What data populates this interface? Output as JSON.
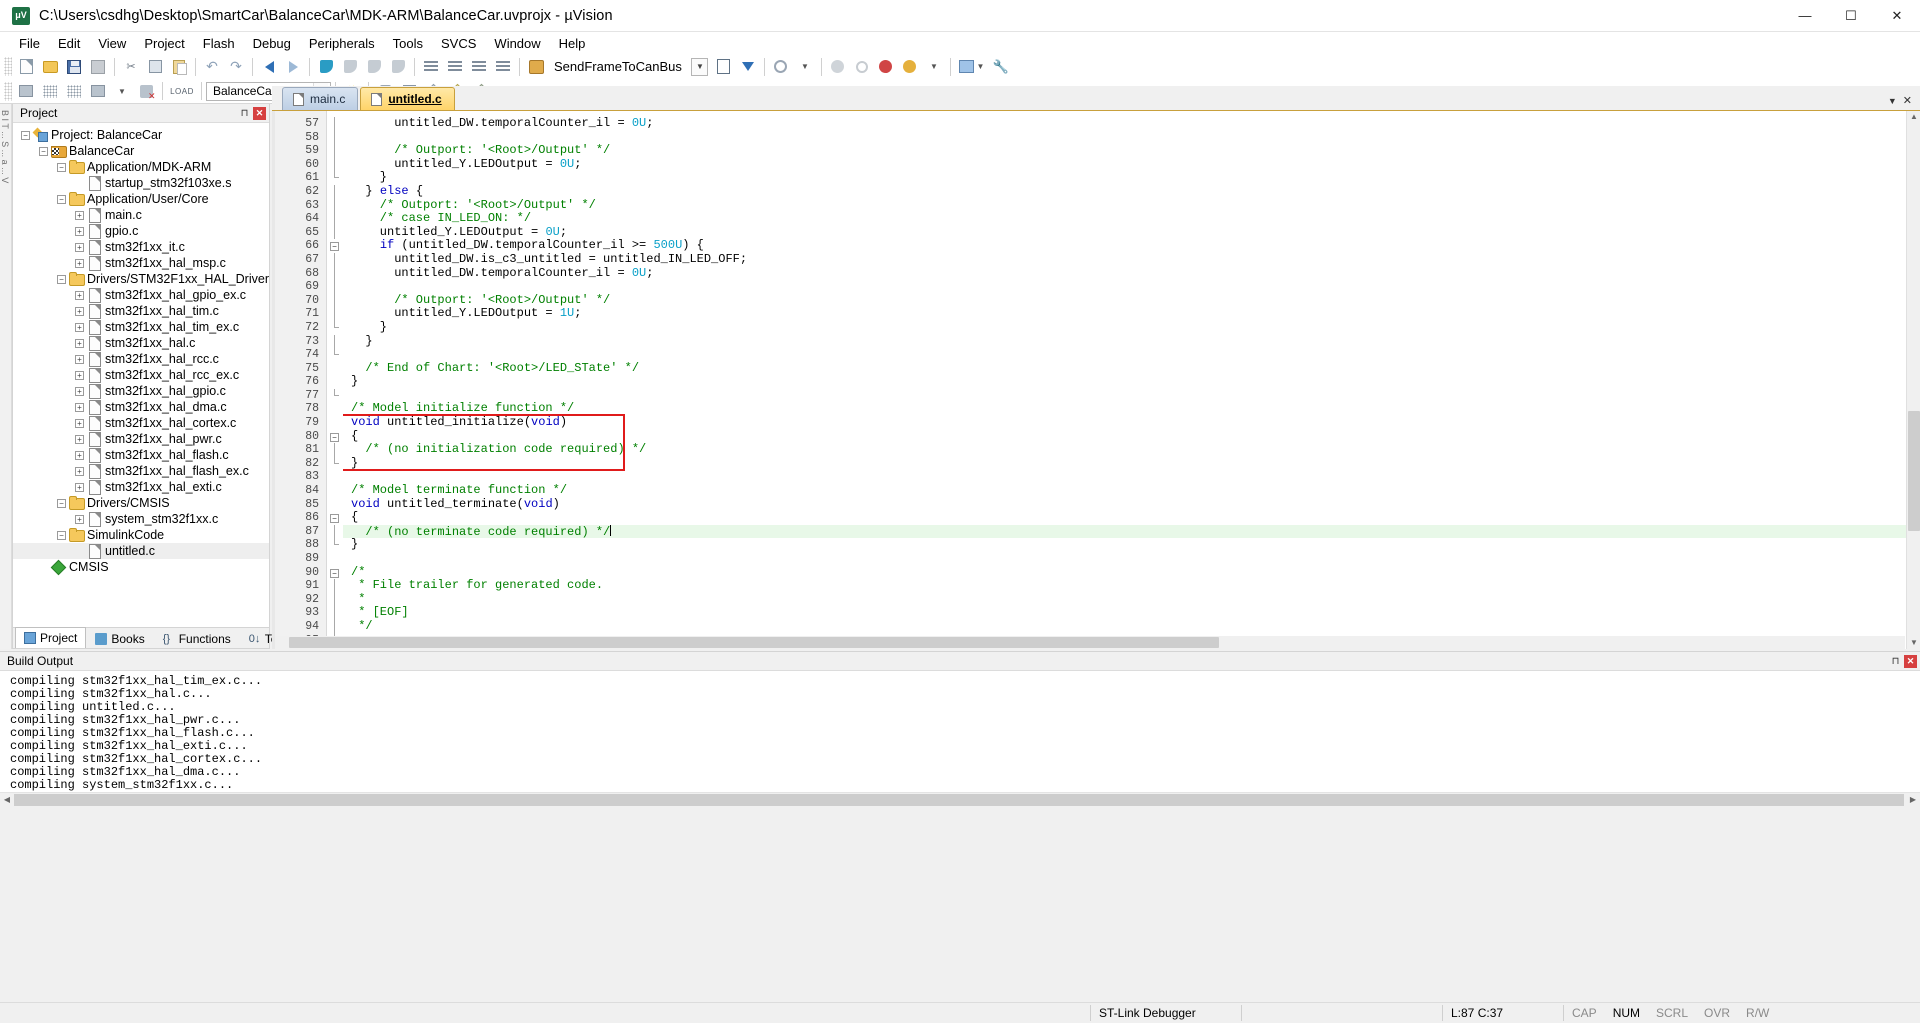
{
  "window": {
    "title": "C:\\Users\\csdhg\\Desktop\\SmartCar\\BalanceCar\\MDK-ARM\\BalanceCar.uvprojx - µVision",
    "app_icon_text": "μV",
    "minimize": "—",
    "maximize": "☐",
    "close": "✕"
  },
  "menu": [
    {
      "label": "File"
    },
    {
      "label": "Edit"
    },
    {
      "label": "View"
    },
    {
      "label": "Project"
    },
    {
      "label": "Flash"
    },
    {
      "label": "Debug"
    },
    {
      "label": "Peripherals"
    },
    {
      "label": "Tools"
    },
    {
      "label": "SVCS"
    },
    {
      "label": "Window"
    },
    {
      "label": "Help"
    }
  ],
  "toolbar": {
    "target_combo_value": "SendFrameToCanBus",
    "project_combo_value": "BalanceCar",
    "load_label": "LOAD"
  },
  "left_strip_text": "B I T ... S ... a ... V",
  "project_panel": {
    "header": "Project",
    "pin_icon": "pin-icon",
    "close_icon": "close-icon",
    "tree": [
      {
        "depth": 0,
        "label": "Project: BalanceCar",
        "icon": "project-icon",
        "expander": "minus"
      },
      {
        "depth": 1,
        "label": "BalanceCar",
        "icon": "target-icon",
        "expander": "minus"
      },
      {
        "depth": 2,
        "label": "Application/MDK-ARM",
        "icon": "folder-icon",
        "expander": "minus"
      },
      {
        "depth": 3,
        "label": "startup_stm32f103xe.s",
        "icon": "file-icon",
        "expander": "none"
      },
      {
        "depth": 2,
        "label": "Application/User/Core",
        "icon": "folder-icon",
        "expander": "minus"
      },
      {
        "depth": 3,
        "label": "main.c",
        "icon": "file-icon",
        "expander": "plus"
      },
      {
        "depth": 3,
        "label": "gpio.c",
        "icon": "file-icon",
        "expander": "plus"
      },
      {
        "depth": 3,
        "label": "stm32f1xx_it.c",
        "icon": "file-icon",
        "expander": "plus"
      },
      {
        "depth": 3,
        "label": "stm32f1xx_hal_msp.c",
        "icon": "file-icon",
        "expander": "plus"
      },
      {
        "depth": 2,
        "label": "Drivers/STM32F1xx_HAL_Driver",
        "icon": "folder-icon",
        "expander": "minus"
      },
      {
        "depth": 3,
        "label": "stm32f1xx_hal_gpio_ex.c",
        "icon": "file-icon",
        "expander": "plus"
      },
      {
        "depth": 3,
        "label": "stm32f1xx_hal_tim.c",
        "icon": "file-icon",
        "expander": "plus"
      },
      {
        "depth": 3,
        "label": "stm32f1xx_hal_tim_ex.c",
        "icon": "file-icon",
        "expander": "plus"
      },
      {
        "depth": 3,
        "label": "stm32f1xx_hal.c",
        "icon": "file-icon",
        "expander": "plus"
      },
      {
        "depth": 3,
        "label": "stm32f1xx_hal_rcc.c",
        "icon": "file-icon",
        "expander": "plus"
      },
      {
        "depth": 3,
        "label": "stm32f1xx_hal_rcc_ex.c",
        "icon": "file-icon",
        "expander": "plus"
      },
      {
        "depth": 3,
        "label": "stm32f1xx_hal_gpio.c",
        "icon": "file-icon",
        "expander": "plus"
      },
      {
        "depth": 3,
        "label": "stm32f1xx_hal_dma.c",
        "icon": "file-icon",
        "expander": "plus"
      },
      {
        "depth": 3,
        "label": "stm32f1xx_hal_cortex.c",
        "icon": "file-icon",
        "expander": "plus"
      },
      {
        "depth": 3,
        "label": "stm32f1xx_hal_pwr.c",
        "icon": "file-icon",
        "expander": "plus"
      },
      {
        "depth": 3,
        "label": "stm32f1xx_hal_flash.c",
        "icon": "file-icon",
        "expander": "plus"
      },
      {
        "depth": 3,
        "label": "stm32f1xx_hal_flash_ex.c",
        "icon": "file-icon",
        "expander": "plus"
      },
      {
        "depth": 3,
        "label": "stm32f1xx_hal_exti.c",
        "icon": "file-icon",
        "expander": "plus"
      },
      {
        "depth": 2,
        "label": "Drivers/CMSIS",
        "icon": "folder-icon",
        "expander": "minus"
      },
      {
        "depth": 3,
        "label": "system_stm32f1xx.c",
        "icon": "file-icon",
        "expander": "plus"
      },
      {
        "depth": 2,
        "label": "SimulinkCode",
        "icon": "folder-icon",
        "expander": "minus"
      },
      {
        "depth": 3,
        "label": "untitled.c",
        "icon": "file-icon",
        "expander": "none",
        "selected": true
      },
      {
        "depth": 1,
        "label": "CMSIS",
        "icon": "cmsis-icon",
        "expander": "none"
      }
    ],
    "tabs": [
      {
        "label": "Project",
        "icon": "project-icon",
        "active": true
      },
      {
        "label": "Books",
        "icon": "books-icon",
        "active": false
      },
      {
        "label": "Functions",
        "icon": "functions-icon",
        "active": false
      },
      {
        "label": "Templates",
        "icon": "templates-icon",
        "active": false
      }
    ]
  },
  "editor": {
    "tabs": [
      {
        "label": "main.c",
        "active": false
      },
      {
        "label": "untitled.c",
        "active": true
      }
    ],
    "first_line_number": 57,
    "lines": [
      {
        "n": 57,
        "fold": "line",
        "segments": [
          {
            "t": "      untitled_DW.temporalCounter_il = "
          },
          {
            "t": "0U",
            "c": "num"
          },
          {
            "t": ";"
          }
        ]
      },
      {
        "n": 58,
        "fold": "line",
        "segments": [
          {
            "t": ""
          }
        ]
      },
      {
        "n": 59,
        "fold": "line",
        "segments": [
          {
            "t": "      /* Outport: '<Root>/Output' */",
            "c": "cm"
          }
        ]
      },
      {
        "n": 60,
        "fold": "line",
        "segments": [
          {
            "t": "      untitled_Y.LEDOutput = "
          },
          {
            "t": "0U",
            "c": "num"
          },
          {
            "t": ";"
          }
        ]
      },
      {
        "n": 61,
        "fold": "endsub",
        "segments": [
          {
            "t": "    }"
          }
        ]
      },
      {
        "n": 62,
        "fold": "line",
        "segments": [
          {
            "t": "  } "
          },
          {
            "t": "else",
            "c": "kw"
          },
          {
            "t": " {"
          }
        ]
      },
      {
        "n": 63,
        "fold": "line",
        "segments": [
          {
            "t": "    /* Outport: '<Root>/Output' */",
            "c": "cm"
          }
        ]
      },
      {
        "n": 64,
        "fold": "line",
        "segments": [
          {
            "t": "    /* case IN_LED_ON: */",
            "c": "cm"
          }
        ]
      },
      {
        "n": 65,
        "fold": "line",
        "segments": [
          {
            "t": "    untitled_Y.LEDOutput = "
          },
          {
            "t": "0U",
            "c": "num"
          },
          {
            "t": ";"
          }
        ]
      },
      {
        "n": 66,
        "fold": "minus",
        "segments": [
          {
            "t": "    "
          },
          {
            "t": "if",
            "c": "kw"
          },
          {
            "t": " (untitled_DW.temporalCounter_il >= "
          },
          {
            "t": "500U",
            "c": "num"
          },
          {
            "t": ") {"
          }
        ]
      },
      {
        "n": 67,
        "fold": "line",
        "segments": [
          {
            "t": "      untitled_DW.is_c3_untitled = untitled_IN_LED_OFF;"
          }
        ]
      },
      {
        "n": 68,
        "fold": "line",
        "segments": [
          {
            "t": "      untitled_DW.temporalCounter_il = "
          },
          {
            "t": "0U",
            "c": "num"
          },
          {
            "t": ";"
          }
        ]
      },
      {
        "n": 69,
        "fold": "line",
        "segments": [
          {
            "t": ""
          }
        ]
      },
      {
        "n": 70,
        "fold": "line",
        "segments": [
          {
            "t": "      /* Outport: '<Root>/Output' */",
            "c": "cm"
          }
        ]
      },
      {
        "n": 71,
        "fold": "line",
        "segments": [
          {
            "t": "      untitled_Y.LEDOutput = "
          },
          {
            "t": "1U",
            "c": "num"
          },
          {
            "t": ";"
          }
        ]
      },
      {
        "n": 72,
        "fold": "endsub",
        "segments": [
          {
            "t": "    }"
          }
        ]
      },
      {
        "n": 73,
        "fold": "line",
        "segments": [
          {
            "t": "  }"
          }
        ]
      },
      {
        "n": 74,
        "fold": "endsub",
        "segments": [
          {
            "t": ""
          }
        ]
      },
      {
        "n": 75,
        "fold": "none",
        "segments": [
          {
            "t": "  /* End of Chart: '<Root>/LED_STate' */",
            "c": "cm"
          }
        ]
      },
      {
        "n": 76,
        "fold": "none",
        "segments": [
          {
            "t": "}"
          }
        ]
      },
      {
        "n": 77,
        "fold": "endtop",
        "segments": [
          {
            "t": ""
          }
        ]
      },
      {
        "n": 78,
        "fold": "none",
        "segments": [
          {
            "t": "/* Model initialize function */",
            "c": "cm"
          }
        ]
      },
      {
        "n": 79,
        "fold": "none",
        "segments": [
          {
            "t": "void",
            "c": "kw"
          },
          {
            "t": " untitled_initialize("
          },
          {
            "t": "void",
            "c": "kw"
          },
          {
            "t": ")"
          }
        ]
      },
      {
        "n": 80,
        "fold": "minus",
        "segments": [
          {
            "t": "{"
          }
        ]
      },
      {
        "n": 81,
        "fold": "line",
        "segments": [
          {
            "t": "  /* (no initialization code required) */",
            "c": "cm"
          }
        ]
      },
      {
        "n": 82,
        "fold": "endsub",
        "segments": [
          {
            "t": "}"
          }
        ]
      },
      {
        "n": 83,
        "fold": "none",
        "segments": [
          {
            "t": ""
          }
        ]
      },
      {
        "n": 84,
        "fold": "none",
        "segments": [
          {
            "t": "/* Model terminate function */",
            "c": "cm"
          }
        ]
      },
      {
        "n": 85,
        "fold": "none",
        "segments": [
          {
            "t": "void",
            "c": "kw"
          },
          {
            "t": " untitled_terminate("
          },
          {
            "t": "void",
            "c": "kw"
          },
          {
            "t": ")"
          }
        ]
      },
      {
        "n": 86,
        "fold": "minus",
        "segments": [
          {
            "t": "{"
          }
        ]
      },
      {
        "n": 87,
        "fold": "line",
        "highlight": true,
        "caret": true,
        "segments": [
          {
            "t": "  /* (no terminate code required) */",
            "c": "cm"
          }
        ]
      },
      {
        "n": 88,
        "fold": "endsub",
        "segments": [
          {
            "t": "}"
          }
        ]
      },
      {
        "n": 89,
        "fold": "none",
        "segments": [
          {
            "t": ""
          }
        ]
      },
      {
        "n": 90,
        "fold": "minus",
        "segments": [
          {
            "t": "/*",
            "c": "cm"
          }
        ]
      },
      {
        "n": 91,
        "fold": "line",
        "segments": [
          {
            "t": " * File trailer for generated code.",
            "c": "cm"
          }
        ]
      },
      {
        "n": 92,
        "fold": "line",
        "segments": [
          {
            "t": " *",
            "c": "cm"
          }
        ]
      },
      {
        "n": 93,
        "fold": "line",
        "segments": [
          {
            "t": " * [EOF]",
            "c": "cm"
          }
        ]
      },
      {
        "n": 94,
        "fold": "line",
        "segments": [
          {
            "t": " */",
            "c": "cm"
          }
        ]
      },
      {
        "n": 95,
        "fold": "endsub",
        "segments": [
          {
            "t": ""
          }
        ]
      }
    ],
    "annotation_box_color": "#e01b1b"
  },
  "build_output": {
    "header": "Build Output",
    "lines": [
      "compiling stm32f1xx_hal_tim_ex.c...",
      "compiling stm32f1xx_hal.c...",
      "compiling untitled.c...",
      "compiling stm32f1xx_hal_pwr.c...",
      "compiling stm32f1xx_hal_flash.c...",
      "compiling stm32f1xx_hal_exti.c...",
      "compiling stm32f1xx_hal_cortex.c...",
      "compiling stm32f1xx_hal_dma.c...",
      "compiling system_stm32f1xx.c..."
    ]
  },
  "statusbar": {
    "debugger": "ST-Link Debugger",
    "position": "L:87 C:37",
    "indicators": [
      "CAP",
      "NUM",
      "SCRL",
      "OVR",
      "R/W"
    ]
  }
}
